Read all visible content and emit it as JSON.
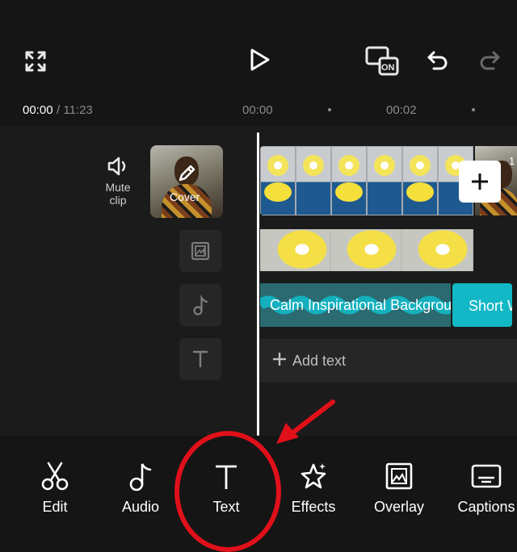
{
  "header": {
    "fullscreen_icon": "expand-icon",
    "play_icon": "play-icon",
    "hd_toggle": "ON",
    "undo_icon": "undo-icon",
    "redo_icon": "redo-icon"
  },
  "ruler": {
    "current_time": "00:00",
    "total_time": "/ 11:23",
    "ticks": [
      "00:00",
      "00:02"
    ]
  },
  "tracks": {
    "mute_label": "Mute\nclip",
    "cover_label": "Cover",
    "audio_title": "Calm Inspirational Backgrou",
    "short_title": "Short W",
    "add_text": "Add text",
    "edge_label": "1"
  },
  "toolbar": {
    "items": [
      {
        "label": "Edit",
        "icon": "scissors-icon"
      },
      {
        "label": "Audio",
        "icon": "music-note-icon"
      },
      {
        "label": "Text",
        "icon": "text-icon"
      },
      {
        "label": "Effects",
        "icon": "sparkle-star-icon"
      },
      {
        "label": "Overlay",
        "icon": "overlay-icon"
      },
      {
        "label": "Captions",
        "icon": "captions-icon"
      }
    ]
  },
  "colors": {
    "background": "#151515",
    "audio_track": "#2a6a70",
    "short_track": "#12b8c6",
    "annotation": "#e0101a"
  }
}
